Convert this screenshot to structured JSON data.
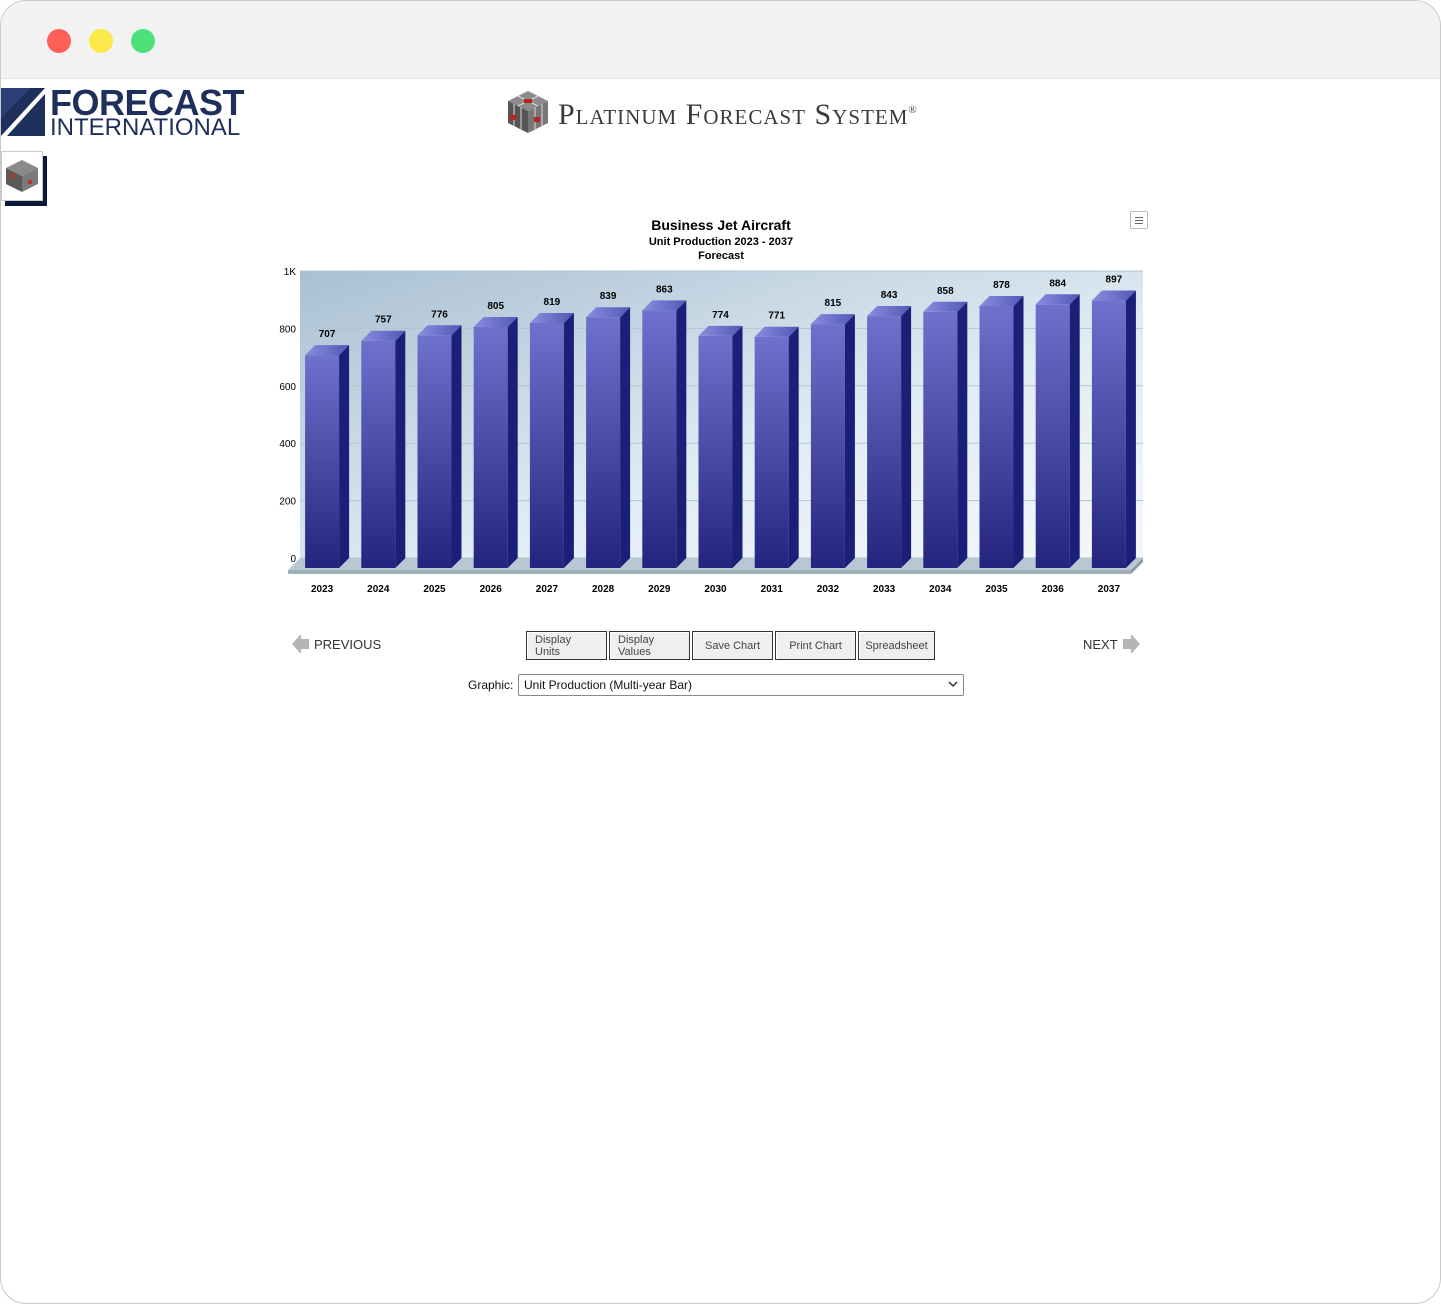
{
  "header": {
    "brand_line1": "FORECAST",
    "brand_line2": "INTERNATIONAL",
    "product_name": "Platinum Forecast System",
    "product_mark": "®"
  },
  "chart_data": {
    "type": "bar",
    "title": "Business Jet Aircraft",
    "subtitle": "Unit Production 2023 - 2037",
    "subtitle2": "Forecast",
    "categories": [
      "2023",
      "2024",
      "2025",
      "2026",
      "2027",
      "2028",
      "2029",
      "2030",
      "2031",
      "2032",
      "2033",
      "2034",
      "2035",
      "2036",
      "2037"
    ],
    "values": [
      707,
      757,
      776,
      805,
      819,
      839,
      863,
      774,
      771,
      815,
      843,
      858,
      878,
      884,
      897
    ],
    "y_ticks": [
      "0",
      "200",
      "400",
      "600",
      "800",
      "1K"
    ],
    "ylim": [
      0,
      1000
    ],
    "grid": true,
    "bar_color": "#3a3da0"
  },
  "navigation": {
    "previous": "PREVIOUS",
    "next": "NEXT"
  },
  "buttons": {
    "display_units": "Display Units",
    "display_values": "Display Values",
    "save_chart": "Save Chart",
    "print_chart": "Print Chart",
    "spreadsheet": "Spreadsheet"
  },
  "graphic": {
    "label": "Graphic:",
    "selected": "Unit Production (Multi-year Bar)"
  }
}
